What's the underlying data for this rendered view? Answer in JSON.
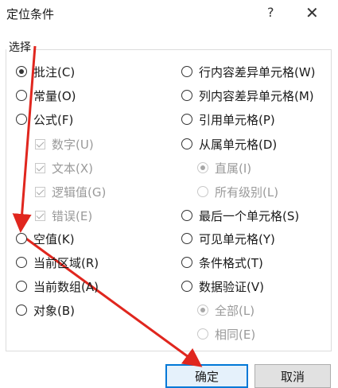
{
  "dialog": {
    "title": "定位条件",
    "help_symbol": "?",
    "close_symbol": "✕",
    "group_label": "选择"
  },
  "left_options": [
    {
      "label": "批注(C)",
      "type": "radio",
      "checked": true,
      "disabled": false
    },
    {
      "label": "常量(O)",
      "type": "radio",
      "checked": false,
      "disabled": false
    },
    {
      "label": "公式(F)",
      "type": "radio",
      "checked": false,
      "disabled": false
    },
    {
      "label": "数字(U)",
      "type": "checkbox",
      "checked": true,
      "disabled": true
    },
    {
      "label": "文本(X)",
      "type": "checkbox",
      "checked": true,
      "disabled": true
    },
    {
      "label": "逻辑值(G)",
      "type": "checkbox",
      "checked": true,
      "disabled": true
    },
    {
      "label": "错误(E)",
      "type": "checkbox",
      "checked": true,
      "disabled": true
    },
    {
      "label": "空值(K)",
      "type": "radio",
      "checked": false,
      "disabled": false
    },
    {
      "label": "当前区域(R)",
      "type": "radio",
      "checked": false,
      "disabled": false
    },
    {
      "label": "当前数组(A)",
      "type": "radio",
      "checked": false,
      "disabled": false
    },
    {
      "label": "对象(B)",
      "type": "radio",
      "checked": false,
      "disabled": false
    }
  ],
  "right_options": [
    {
      "label": "行内容差异单元格(W)",
      "type": "radio",
      "checked": false,
      "disabled": false
    },
    {
      "label": "列内容差异单元格(M)",
      "type": "radio",
      "checked": false,
      "disabled": false
    },
    {
      "label": "引用单元格(P)",
      "type": "radio",
      "checked": false,
      "disabled": false
    },
    {
      "label": "从属单元格(D)",
      "type": "radio",
      "checked": false,
      "disabled": false
    },
    {
      "label": "直属(I)",
      "type": "radio",
      "checked": true,
      "disabled": true
    },
    {
      "label": "所有级别(L)",
      "type": "radio",
      "checked": false,
      "disabled": true
    },
    {
      "label": "最后一个单元格(S)",
      "type": "radio",
      "checked": false,
      "disabled": false
    },
    {
      "label": "可见单元格(Y)",
      "type": "radio",
      "checked": false,
      "disabled": false
    },
    {
      "label": "条件格式(T)",
      "type": "radio",
      "checked": false,
      "disabled": false
    },
    {
      "label": "数据验证(V)",
      "type": "radio",
      "checked": false,
      "disabled": false
    },
    {
      "label": "全部(L)",
      "type": "radio",
      "checked": true,
      "disabled": true
    },
    {
      "label": "相同(E)",
      "type": "radio",
      "checked": false,
      "disabled": true
    }
  ],
  "buttons": {
    "ok_label": "确定",
    "cancel_label": "取消"
  },
  "annotation_color": "#e0261e"
}
